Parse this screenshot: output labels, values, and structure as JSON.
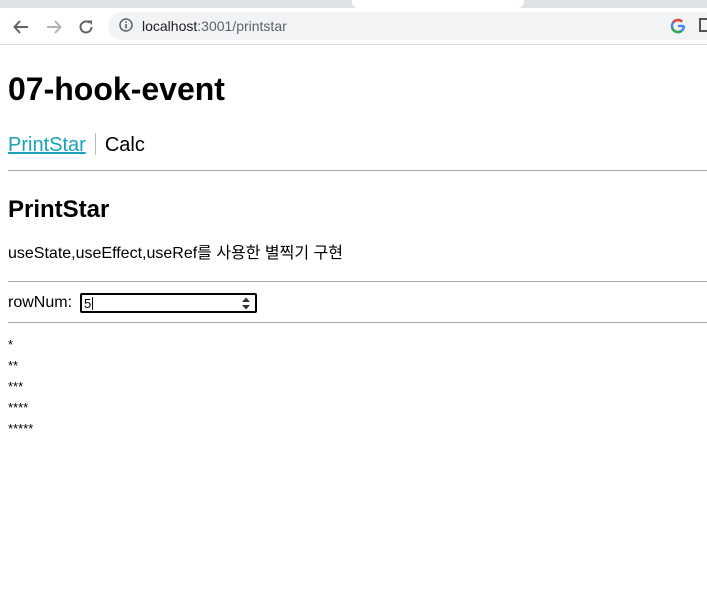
{
  "browser": {
    "url_host": "localhost",
    "url_path": ":3001/printstar"
  },
  "page": {
    "title": "07-hook-event",
    "nav": {
      "printstar_label": "PrintStar",
      "calc_label": "Calc"
    },
    "section_title": "PrintStar",
    "description": "useState,useEffect,useRef를 사용한 별찍기 구현",
    "row_num": {
      "label": "rowNum:",
      "value": "5"
    },
    "stars": [
      "*",
      "**",
      "***",
      "****",
      "*****"
    ]
  },
  "colors": {
    "link": "#17a2b8",
    "divider": "#a9a9a9"
  }
}
